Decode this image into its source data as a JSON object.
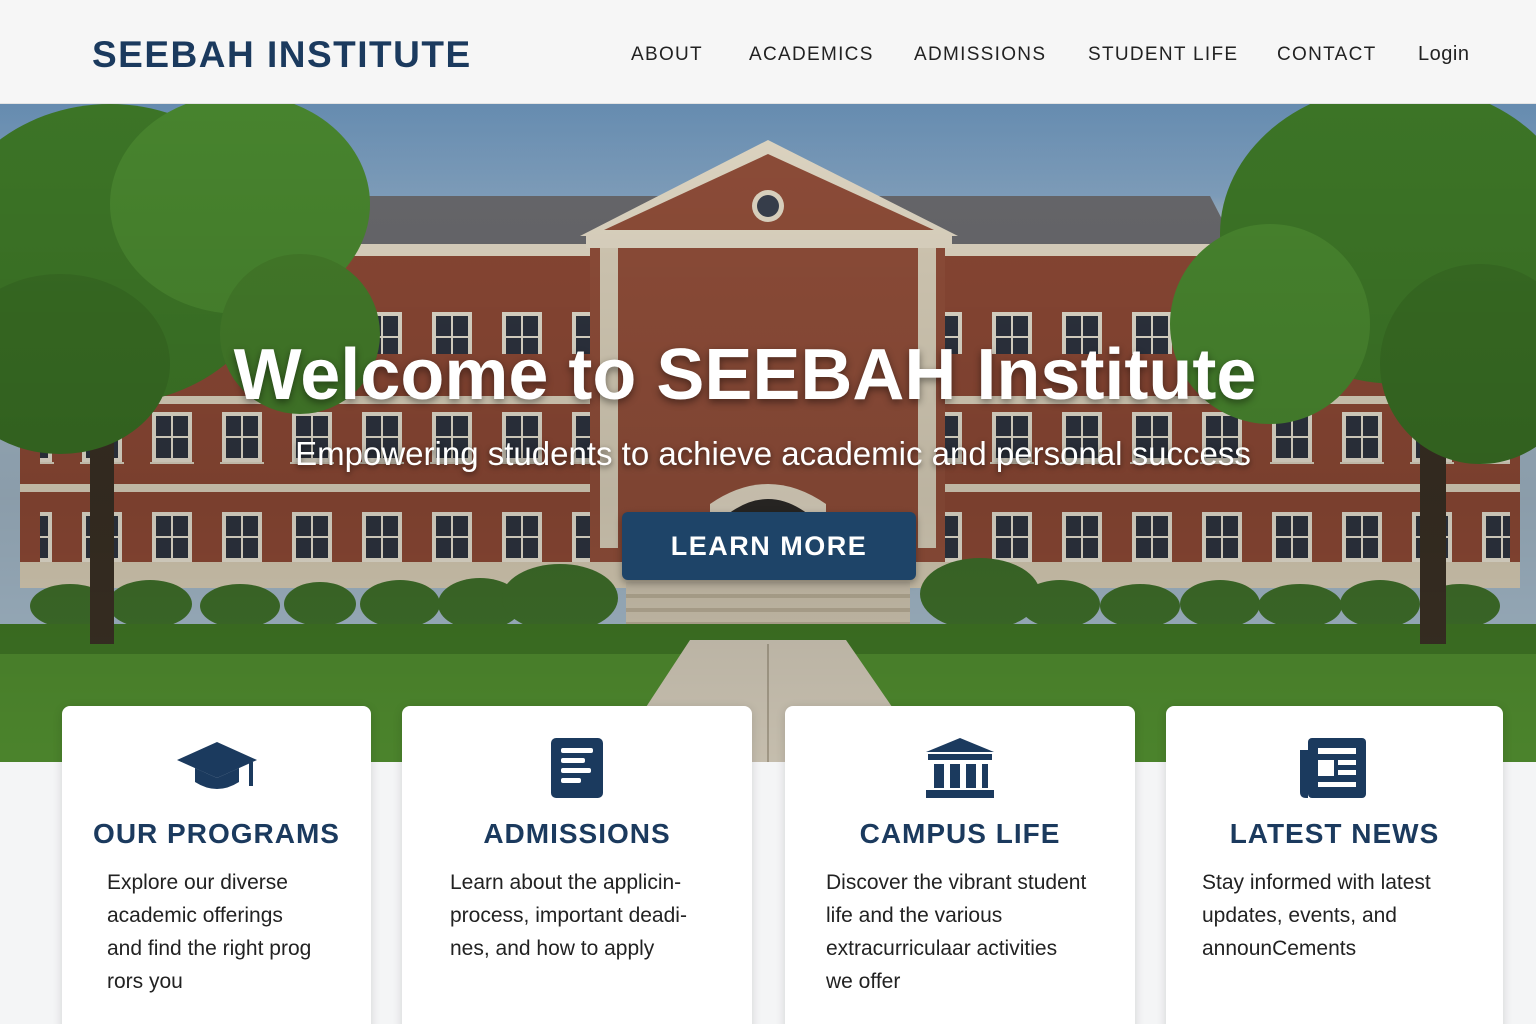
{
  "header": {
    "logo": "SEEBAH INSTITUTE",
    "nav": [
      "ABOUT",
      "ACADEMICS",
      "ADMISSIONS",
      "STUDENT LIFE",
      "CONTACT"
    ],
    "login": "Login"
  },
  "hero": {
    "title": "Welcome to SEEBAH Institute",
    "subtitle": "Empowering students to achieve academic and personal success",
    "cta": "LEARN MORE"
  },
  "cards": [
    {
      "icon": "graduation-cap-icon",
      "title": "OUR PROGRAMS",
      "lines": [
        "Explore our diverse",
        "academic offerings",
        "and find the right prog",
        "rors you"
      ]
    },
    {
      "icon": "document-icon",
      "title": "ADMISSIONS",
      "lines": [
        "Learn about the applicin-",
        "process, important deadi-",
        "nes, and how to apply"
      ]
    },
    {
      "icon": "institution-icon",
      "title": "CAMPUS LIFE",
      "lines": [
        "Discover the vibrant student",
        "life and the various",
        "extracurriculaar activities",
        "we offer"
      ]
    },
    {
      "icon": "newspaper-icon",
      "title": "LATEST NEWS",
      "lines": [
        "Stay informed with latest",
        "updates, events, and",
        "announCements"
      ]
    }
  ],
  "colors": {
    "brand": "#1b3a5e",
    "button": "#1e4468",
    "brick": "#8f4a36",
    "lawn": "#4f8a2e"
  }
}
